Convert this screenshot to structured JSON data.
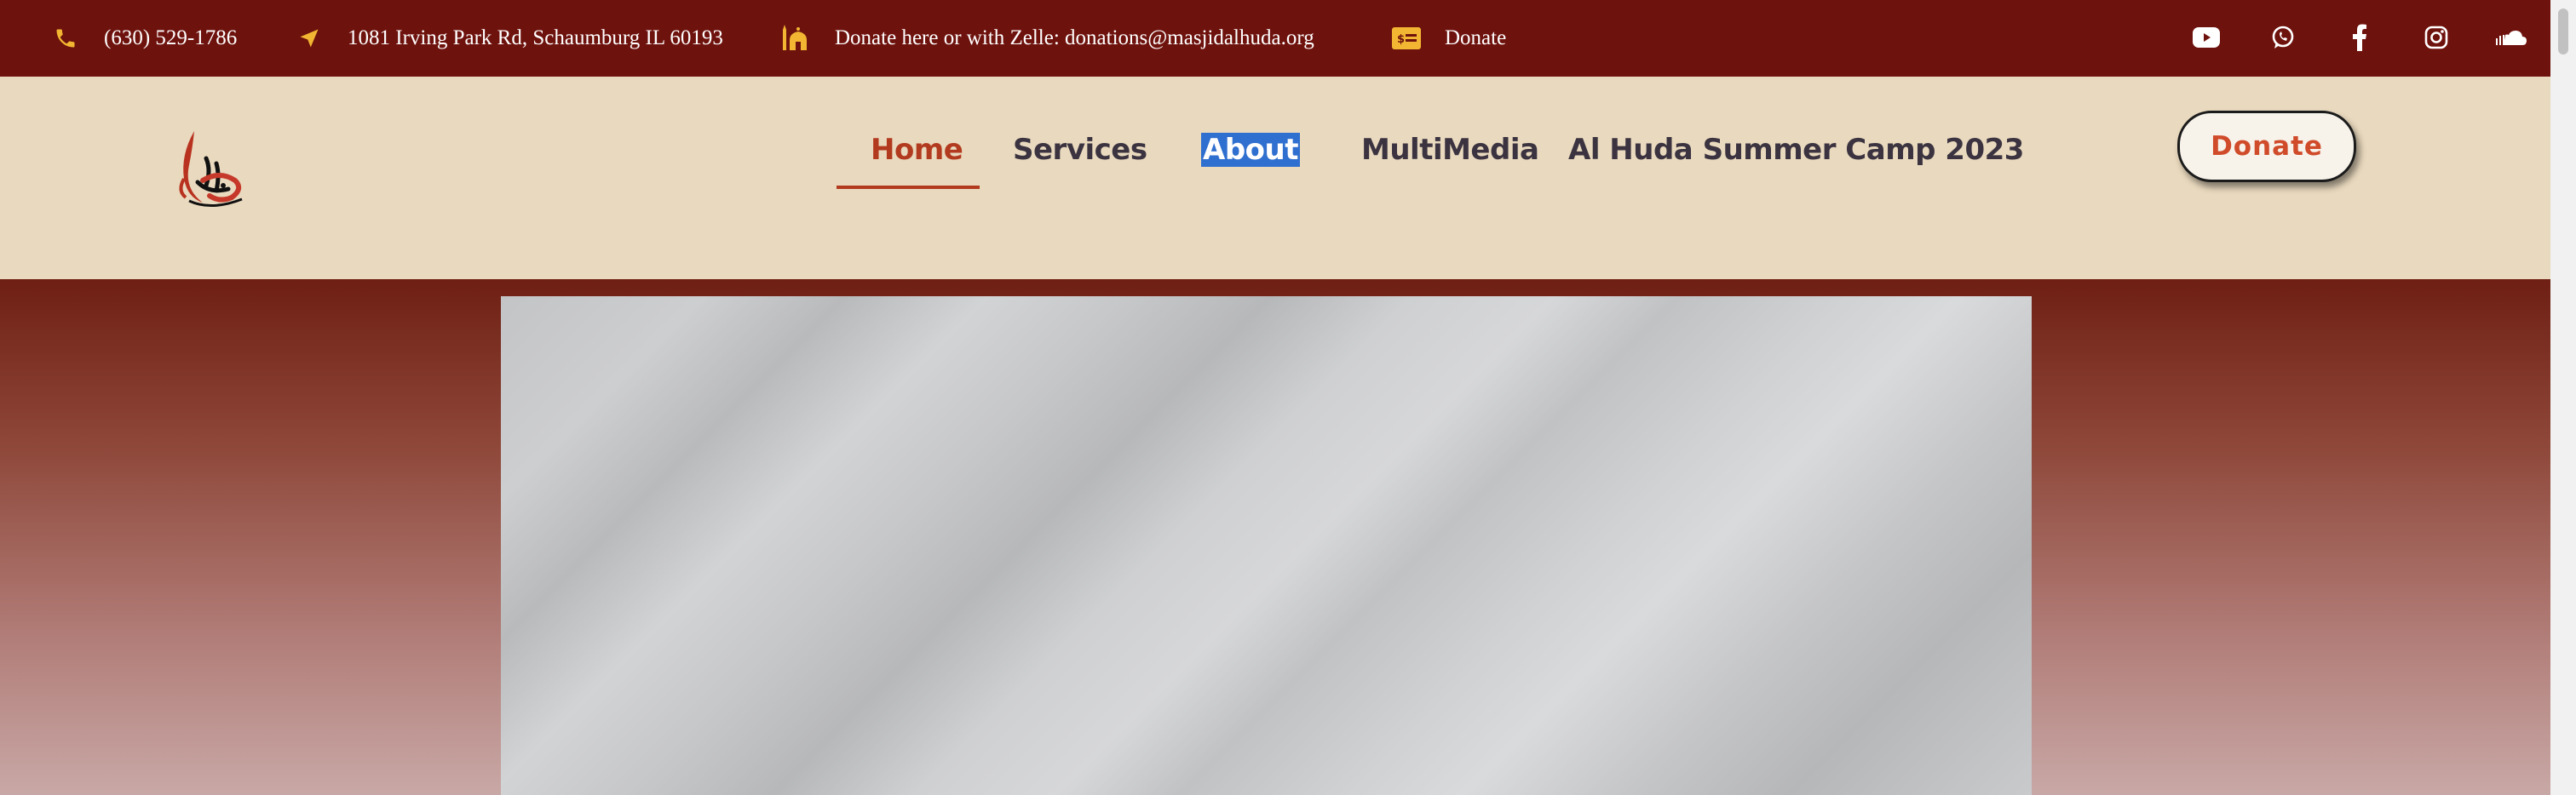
{
  "topbar": {
    "phone": "(630) 529-1786",
    "address": "1081 Irving Park Rd, Schaumburg IL 60193",
    "zelle": "Donate here or with Zelle: donations@masjidalhuda.org",
    "donate": "Donate",
    "icon_color": "#f2b632",
    "background": "#6e120d",
    "icons": [
      "phone-icon",
      "location-arrow-icon",
      "mosque-icon",
      "donation-card-icon"
    ],
    "social_icons": [
      "youtube-icon",
      "whatsapp-icon",
      "facebook-icon",
      "instagram-icon",
      "soundcloud-icon"
    ]
  },
  "nav": {
    "items": [
      {
        "label": "Home",
        "active": true
      },
      {
        "label": "Services"
      },
      {
        "label": "About",
        "selected": true
      },
      {
        "label": "MultiMedia"
      },
      {
        "label": "Al Huda Summer Camp 2023"
      }
    ],
    "active_color": "#b23a1e",
    "donate_button": "Donate"
  },
  "header": {
    "background": "#e9d9be"
  }
}
